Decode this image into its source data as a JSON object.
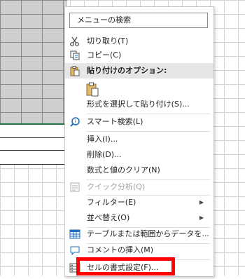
{
  "menu": {
    "search_placeholder": "メニューの検索",
    "items": [
      {
        "label": "切り取り(T)",
        "icon": "scissors-icon",
        "enabled": true
      },
      {
        "label": "コピー(C)",
        "icon": "copy-icon",
        "enabled": true
      },
      {
        "label": "貼り付けのオプション:",
        "icon": "paste-icon",
        "enabled": true,
        "header": true
      },
      {
        "label": "形式を選択して貼り付け(S)...",
        "enabled": true
      },
      {
        "label": "スマート検索(L)",
        "icon": "smart-lookup-icon",
        "enabled": true
      },
      {
        "label": "挿入(I)...",
        "enabled": true
      },
      {
        "label": "削除(D)...",
        "enabled": true
      },
      {
        "label": "数式と値のクリア(N)",
        "enabled": true
      },
      {
        "label": "クイック分析(Q)",
        "icon": "quick-analysis-icon",
        "enabled": false
      },
      {
        "label": "フィルター(E)",
        "enabled": true,
        "submenu": true
      },
      {
        "label": "並べ替え(O)",
        "enabled": true,
        "submenu": true
      },
      {
        "label": "テーブルまたは範囲からデータを...",
        "icon": "table-icon",
        "enabled": true
      },
      {
        "label": "コメントの挿入(M)",
        "icon": "comment-icon",
        "enabled": true
      },
      {
        "label": "セルの書式設定(F)...",
        "icon": "format-cells-icon",
        "enabled": true
      }
    ]
  },
  "colors": {
    "highlight": "#ff0000",
    "selection_gray": "#cfcfcf",
    "accent_green": "#217346"
  }
}
